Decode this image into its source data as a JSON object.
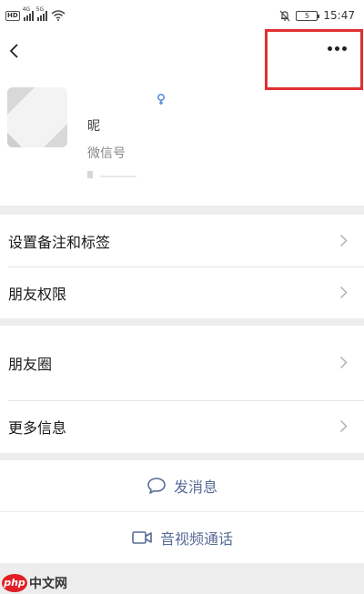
{
  "status_bar": {
    "hd_badge": "HD",
    "net_labels": [
      "4G",
      "5G"
    ],
    "time": "15:47",
    "battery_level": "5",
    "icons": [
      "signal-icon",
      "wifi-icon",
      "mute-bell-icon",
      "battery-icon"
    ]
  },
  "header": {
    "back_icon": "chevron-left-icon",
    "more_icon": "more-dots-icon",
    "highlight_color": "#e0302f"
  },
  "profile": {
    "name": "昵",
    "wechat_id_label": "微信号"
  },
  "menu": {
    "group1": [
      {
        "label": "设置备注和标签"
      },
      {
        "label": "朋友权限"
      }
    ],
    "group2": [
      {
        "label": "朋友圈"
      },
      {
        "label": "更多信息"
      }
    ]
  },
  "actions": {
    "send_message": "发消息",
    "av_call": "音视频通话",
    "accent_color": "#576b95"
  },
  "watermark": {
    "logo": "php",
    "text": "中文网"
  }
}
